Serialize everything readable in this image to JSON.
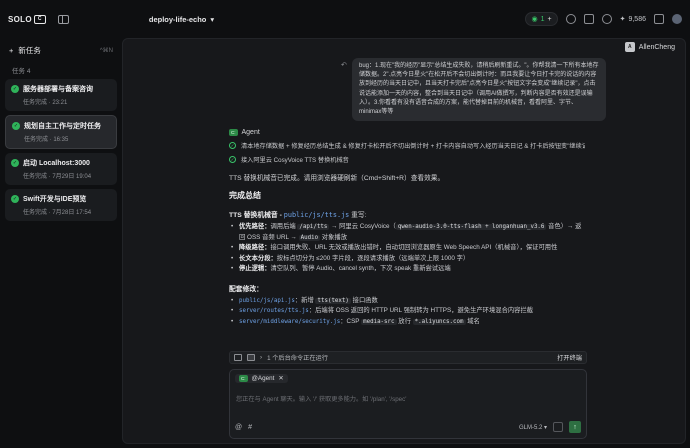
{
  "app": {
    "logo_text": "SOLO",
    "logo_box": "C"
  },
  "topbar": {
    "project": "deploy-life-echo",
    "run_status": "1",
    "stars": "9,586"
  },
  "sidebar": {
    "new_task_label": "新任务",
    "new_task_shortcut": "^⌘N",
    "group_label": "任务",
    "group_count": "4",
    "tasks": [
      {
        "title": "服务器部署与备案咨询",
        "sub": "任务完成 · 23:21"
      },
      {
        "title": "规划自主工作与定时任务",
        "sub": "任务完成 · 16:35"
      },
      {
        "title": "启动 Localhost:3000",
        "sub": "任务完成 · 7月29日 19:04"
      },
      {
        "title": "Swift开发与IDE预览",
        "sub": "任务完成 · 7月28日 17:54"
      }
    ]
  },
  "chat": {
    "user_name": "AllenCheng",
    "user_message": "bug：1.现在\"我的经历\"显示\"总结生成失败，请稍后刷新重试。\"。你帮我清一下所有本地存储数据。2\".点亮今日星火\"在松开后不会切出倒计时：而且我要让今日打卡完的说话的内容放到经历的当天日记中，且当天打卡完后\"点亮今日星火\"按钮文字会变成\"继续记录\"，点击说话能添加一天的内容，整合到当天日记中（调用AI做撰写，判断内容是否有效还是误输入）。3.你看看有没有语音合成的方案，能代替掉目前的机械音，看看阿里、字节、minimax等等",
    "agent_label": "Agent",
    "steps": [
      "清本地存储数据 + 修复经历总结生成 & 修复打卡松开后不切出倒计时 + 打卡内容自动写入经历当天日记 & 打卡后按钮变\"继续记...",
      "接入阿里云 CosyVoice TTS 替换机械音"
    ],
    "para1": "TTS 替换机械音已完成。请用浏览器硬刷新（Cmd+Shift+R）查看效果。",
    "summary_title": "完成总结",
    "section1_prefix": "TTS 替换机械音 -",
    "section1_file": "public/js/tts.js",
    "section1_suffix": "重写:",
    "bullets": [
      {
        "label": "优先路径：",
        "text1": "调用后端 ",
        "code1": "/api/tts",
        "text2": " → 阿里云 CosyVoice（",
        "code2": "qwen-audio-3.0-tts-flash + longanhuan_v3.6",
        "text3": " 音色）→ 返回 OSS 音频 URL → ",
        "code3": "Audio",
        "text4": " 对象播放"
      },
      {
        "label": "降级路径：",
        "text1": "接口调用失败、URL 无效或播放出错时，自动切回浏览器原生 Web Speech API（机械音），保证可用性"
      },
      {
        "label": "长文本分段：",
        "text1": "按标点切分为 ≤200 字片段，逐段请求播放（远端单次上限 1000 字）"
      },
      {
        "label": "停止逻辑：",
        "text1": "清空队列、暂停 Audio、cancel synth，下次 speak 重新尝试远端"
      }
    ],
    "config_title": "配套修改：",
    "config": [
      {
        "file": "public/js/api.js",
        "text1": "：新增 ",
        "code1": "tts(text)",
        "text2": " 接口函数"
      },
      {
        "file": "server/routes/tts.js",
        "text1": "：后端将 OSS 返回的 HTTP URL 强制转为 HTTPS，避免生产环境混合内容拦截"
      },
      {
        "file": "server/middleware/security.js",
        "text1": "：CSP ",
        "code1": "media-src",
        "text2": " 放行 ",
        "code2": "*.aliyuncs.com",
        "text3": " 域名"
      }
    ]
  },
  "terminal": {
    "status": "1 个后台命令正在运行",
    "open_label": "打开终端"
  },
  "composer": {
    "mention": "@Agent",
    "placeholder": "您正在与 Agent 聊天。输入 '/' 获取更多能力。如 '/plan', '/spec'",
    "model": "GLM-5.2"
  }
}
